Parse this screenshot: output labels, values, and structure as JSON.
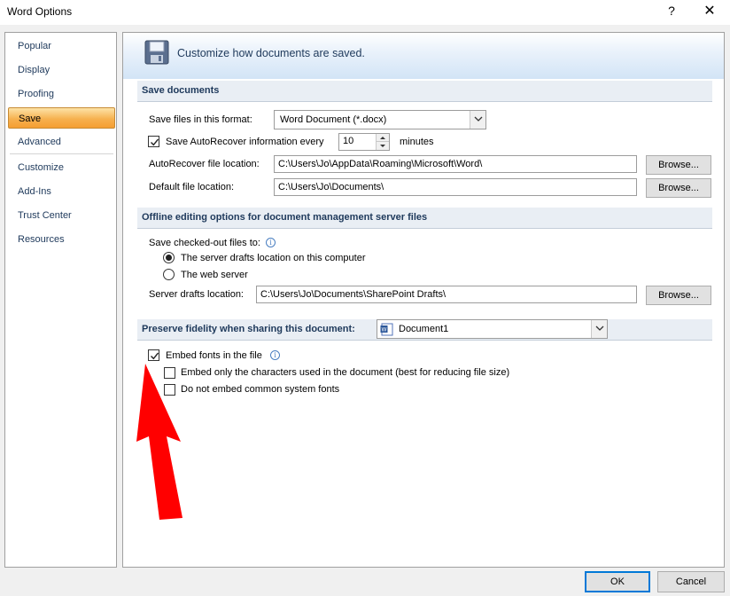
{
  "window": {
    "title": "Word Options",
    "help": "?",
    "close": "✕"
  },
  "sidebar": {
    "items": [
      {
        "label": "Popular"
      },
      {
        "label": "Display"
      },
      {
        "label": "Proofing"
      },
      {
        "label": "Save"
      },
      {
        "label": "Advanced"
      },
      {
        "label": "Customize"
      },
      {
        "label": "Add-Ins"
      },
      {
        "label": "Trust Center"
      },
      {
        "label": "Resources"
      }
    ],
    "selected": "Save"
  },
  "header": {
    "title": "Customize how documents are saved."
  },
  "save_documents": {
    "heading": "Save documents",
    "format_label": "Save files in this format:",
    "format_value": "Word Document (*.docx)",
    "autorecover_label": "Save AutoRecover information every",
    "autorecover_checked": true,
    "autorecover_minutes": "10",
    "minutes_label": "minutes",
    "autorecover_location_label": "AutoRecover file location:",
    "autorecover_location_value": "C:\\Users\\Jo\\AppData\\Roaming\\Microsoft\\Word\\",
    "default_location_label": "Default file location:",
    "default_location_value": "C:\\Users\\Jo\\Documents\\",
    "browse_label": "Browse..."
  },
  "offline": {
    "heading": "Offline editing options for document management server files",
    "save_checked_out_label": "Save checked-out files to:",
    "option_server": "The server drafts location on this computer",
    "option_web": "The web server",
    "selected_option": "The server drafts location on this computer",
    "drafts_location_label": "Server drafts location:",
    "drafts_location_value": "C:\\Users\\Jo\\Documents\\SharePoint Drafts\\",
    "browse_label": "Browse..."
  },
  "fidelity": {
    "heading": "Preserve fidelity when sharing this document:",
    "document_value": "Document1",
    "embed_fonts_label": "Embed fonts in the file",
    "embed_fonts_checked": true,
    "embed_only_chars_label": "Embed only the characters used in the document (best for reducing file size)",
    "embed_only_chars_checked": false,
    "no_common_fonts_label": "Do not embed common system fonts",
    "no_common_fonts_checked": false
  },
  "footer": {
    "ok_label": "OK",
    "cancel_label": "Cancel"
  },
  "colors": {
    "accent_orange": "#f6b14f",
    "annotation_arrow": "#ff0000",
    "section_text": "#1e395b"
  }
}
